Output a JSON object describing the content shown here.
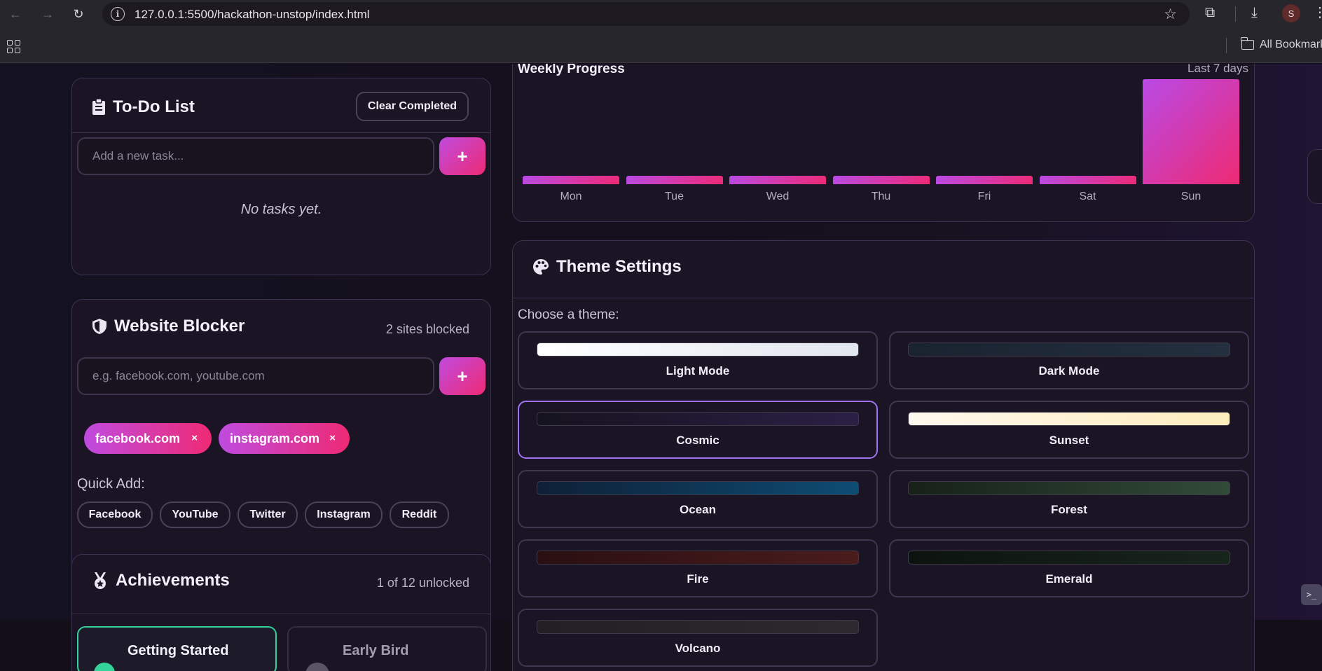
{
  "browser": {
    "url": "127.0.0.1:5500/hackathon-unstop/index.html",
    "bookmarks_label": "All Bookmarks",
    "profile_initial": "S"
  },
  "todo": {
    "title": "To-Do List",
    "clear_label": "Clear Completed",
    "input_placeholder": "Add a new task...",
    "add_label": "+",
    "empty_text": "No tasks yet."
  },
  "blocker": {
    "title": "Website Blocker",
    "count": "2 sites blocked",
    "input_placeholder": "e.g. facebook.com, youtube.com",
    "add_label": "+",
    "blocked": [
      "facebook.com",
      "instagram.com"
    ],
    "remove_label": "×",
    "quick_add_label": "Quick Add:",
    "quick_add": [
      "Facebook",
      "YouTube",
      "Twitter",
      "Instagram",
      "Reddit"
    ]
  },
  "achievements": {
    "title": "Achievements",
    "count": "1 of 12 unlocked",
    "items": [
      "Getting Started",
      "Early Bird"
    ]
  },
  "weekly": {
    "title": "Weekly Progress",
    "range": "Last 7 days"
  },
  "chart_data": {
    "type": "bar",
    "categories": [
      "Mon",
      "Tue",
      "Wed",
      "Thu",
      "Fri",
      "Sat",
      "Sun"
    ],
    "values": [
      0.08,
      0.08,
      0.08,
      0.08,
      0.08,
      0.08,
      1.0
    ],
    "title": "Weekly Progress",
    "ylim": [
      0,
      1
    ]
  },
  "themes": {
    "title": "Theme Settings",
    "prompt": "Choose a theme:",
    "selected": "Cosmic",
    "options": [
      {
        "name": "Light Mode",
        "swatch": [
          "#ffffff",
          "#e2e6ef"
        ]
      },
      {
        "name": "Dark Mode",
        "swatch": [
          "#1a2330",
          "#24303f"
        ]
      },
      {
        "name": "Cosmic",
        "swatch": [
          "#16131f",
          "#2b1f45"
        ]
      },
      {
        "name": "Sunset",
        "swatch": [
          "#fff8ee",
          "#fdedbe"
        ]
      },
      {
        "name": "Ocean",
        "swatch": [
          "#0e2036",
          "#0e4c73"
        ]
      },
      {
        "name": "Forest",
        "swatch": [
          "#172119",
          "#324a38"
        ]
      },
      {
        "name": "Fire",
        "swatch": [
          "#2a0f12",
          "#4a1c1c"
        ]
      },
      {
        "name": "Emerald",
        "swatch": [
          "#0d140f",
          "#17241b"
        ]
      },
      {
        "name": "Volcano",
        "swatch": [
          "#222024",
          "#2c2a2e"
        ]
      }
    ]
  },
  "colors": {
    "accent_start": "#c04be0",
    "accent_end": "#ee2a74",
    "selected_border": "#a074f0",
    "achievement_border": "#34d399"
  }
}
